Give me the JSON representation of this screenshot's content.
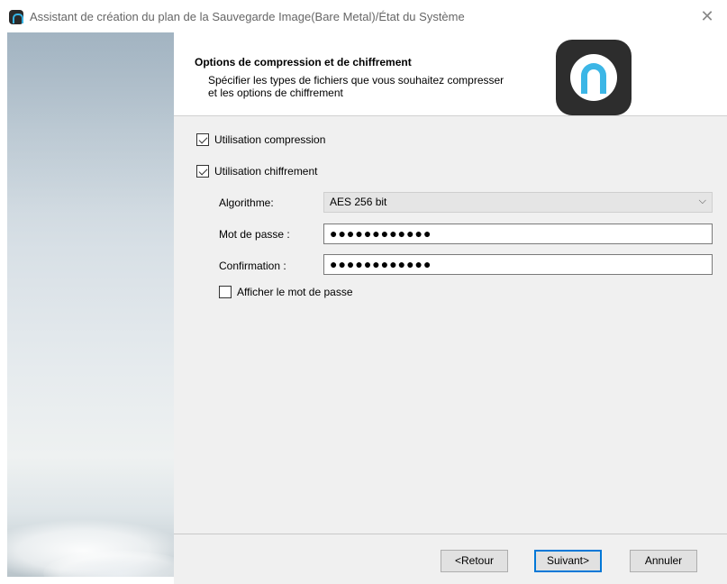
{
  "window": {
    "title": "Assistant de création du plan de la Sauvegarde Image(Bare Metal)/État du Système",
    "close_glyph": "✕"
  },
  "header": {
    "title": "Options de compression et de chiffrement",
    "description": "Spécifier les types de fichiers que vous souhaitez compresser et les options de chiffrement"
  },
  "options": {
    "compression": {
      "label": "Utilisation compression",
      "checked": true
    },
    "encryption": {
      "label": "Utilisation chiffrement",
      "checked": true
    }
  },
  "fields": {
    "algorithm": {
      "label": "Algorithme:",
      "value": "AES 256 bit"
    },
    "password": {
      "label": "Mot de passe :",
      "value": "●●●●●●●●●●●●"
    },
    "confirmation": {
      "label": "Confirmation :",
      "value": "●●●●●●●●●●●●"
    },
    "show_password": {
      "label": "Afficher le mot de passe",
      "checked": false
    }
  },
  "buttons": {
    "back": "<Retour",
    "next": "Suivant>",
    "cancel": "Annuler"
  },
  "icons": {
    "app": "app-logo-icon",
    "close": "close-icon",
    "dropdown": "chevron-down-icon"
  },
  "colors": {
    "accent": "#0078d7",
    "logo_blue": "#3cb6e6",
    "logo_dark": "#2d2d2d"
  }
}
